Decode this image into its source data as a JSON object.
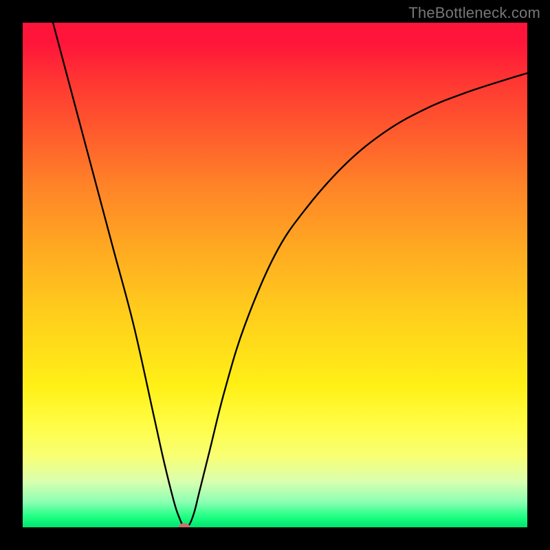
{
  "watermark": "TheBottleneck.com",
  "colors": {
    "gradient_top": "#ff153a",
    "gradient_bottom": "#00e36e",
    "curve": "#000000",
    "marker": "#cd6f6d",
    "frame": "#000000"
  },
  "chart_data": {
    "type": "line",
    "title": "",
    "xlabel": "",
    "ylabel": "",
    "xlim": [
      0,
      100
    ],
    "ylim": [
      0,
      100
    ],
    "series": [
      {
        "name": "bottleneck-curve",
        "x": [
          6,
          10,
          14,
          18,
          22,
          26,
          28,
          30,
          31,
          32,
          33,
          34,
          35,
          37,
          40,
          44,
          50,
          56,
          64,
          72,
          80,
          88,
          96,
          100
        ],
        "y": [
          100,
          85,
          70,
          55,
          40,
          22,
          13,
          5,
          2,
          0,
          0.5,
          3,
          7,
          15,
          27,
          40,
          54,
          63,
          72,
          78.5,
          83,
          86.2,
          88.8,
          90
        ]
      }
    ],
    "marker": {
      "x": 32,
      "y": 0
    }
  }
}
